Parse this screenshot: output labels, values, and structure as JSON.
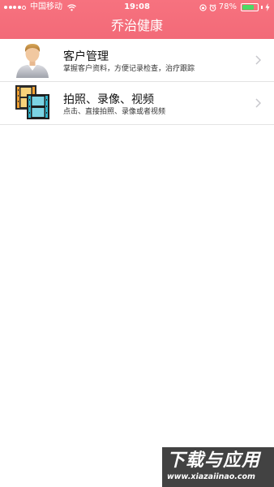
{
  "status_bar": {
    "carrier": "中国移动",
    "time": "19:08",
    "battery_percent": "78%",
    "battery_level": 0.78,
    "signal_bars_filled": 4,
    "icons": [
      "signal-dots-icon",
      "wifi-icon",
      "rotation-lock-icon",
      "alarm-icon",
      "battery-icon",
      "charging-bolt-icon"
    ]
  },
  "nav": {
    "title": "乔治健康",
    "background_color": "#f26a78"
  },
  "list": {
    "items": [
      {
        "title": "客户管理",
        "subtitle": "掌握客户资料，方便记录检查，治疗跟踪",
        "icon": "customer-avatar-icon"
      },
      {
        "title": "拍照、录像、视频",
        "subtitle": "点击、直接拍照、录像或者视频",
        "icon": "film-strip-icon"
      }
    ]
  },
  "watermark": {
    "main_text": "下载与应用",
    "url": "www.xiazaiinao.com"
  }
}
